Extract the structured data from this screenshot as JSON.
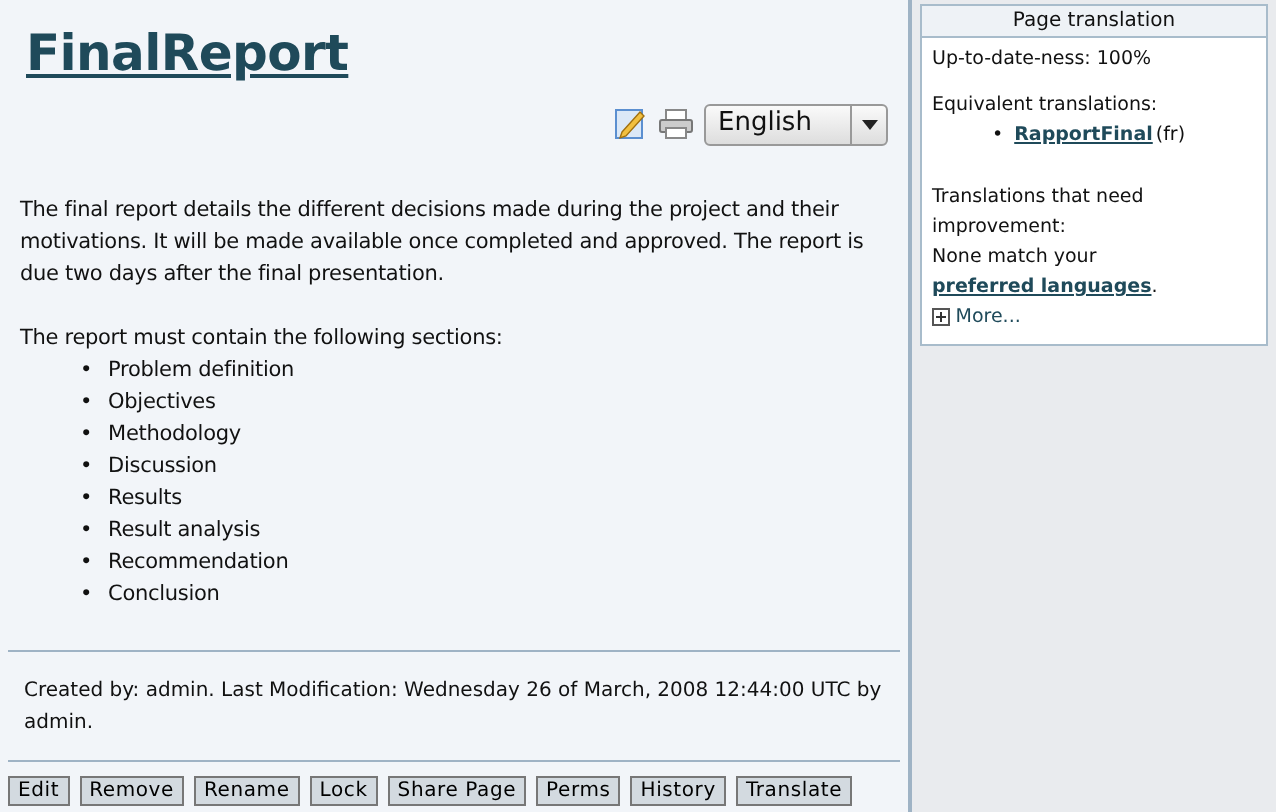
{
  "page": {
    "title": "FinalReport",
    "language": "English",
    "paragraphs": [
      "The final report details the different decisions made during the project and their motivations. It will be made available once completed and approved. The report is due two days after the final presentation.",
      "The report must contain the following sections:"
    ],
    "sections": [
      {
        "bullet": "•",
        "text": "Problem definition"
      },
      {
        "bullet": "•",
        "text": "Objectives"
      },
      {
        "bullet": "•",
        "text": "Methodology"
      },
      {
        "bullet": "•",
        "text": "Discussion"
      },
      {
        "bullet": "•",
        "text": "Results"
      },
      {
        "bullet": "•",
        "text": "Result analysis"
      },
      {
        "bullet": "•",
        "text": "Recommendation"
      },
      {
        "bullet": "•",
        "text": "Conclusion"
      }
    ],
    "footer": "Created by: admin. Last Modification: Wednesday 26 of March, 2008 12:44:00 UTC by admin.",
    "buttons": [
      "Edit",
      "Remove",
      "Rename",
      "Lock",
      "Share Page",
      "Perms",
      "History",
      "Translate"
    ]
  },
  "sidebar": {
    "title": "Page translation",
    "up_to_date": "Up-to-date-ness: 100%",
    "equivalent_label": "Equivalent translations:",
    "equivalents": [
      {
        "bullet": "•",
        "link": "RapportFinal",
        "lang": "(fr)"
      }
    ],
    "need_label": "Translations that need improvement:",
    "none_prefix": "None match your",
    "none_link": "preferred languages",
    "none_suffix": ".",
    "more": "More..."
  }
}
